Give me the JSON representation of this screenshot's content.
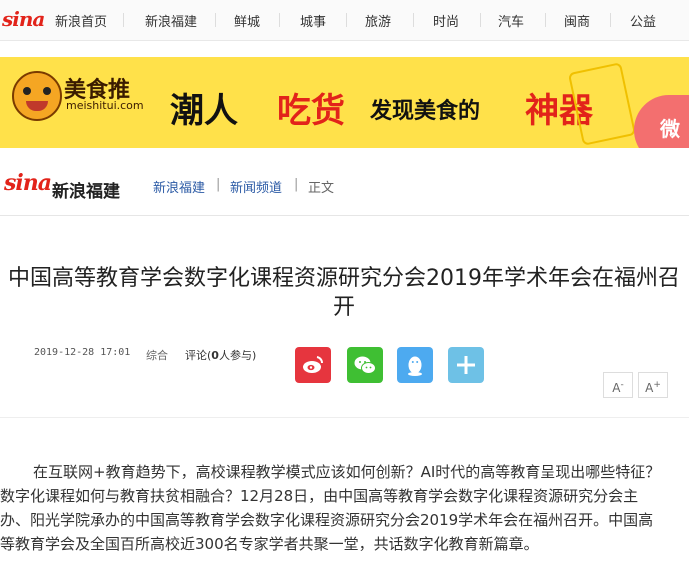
{
  "topnav": {
    "logo": "sina",
    "items": [
      "新浪首页",
      "新浪福建",
      "鲜城",
      "城事",
      "旅游",
      "时尚",
      "汽车",
      "闽商",
      "公益"
    ]
  },
  "banner": {
    "brand": "美食推",
    "domain": "meishitui.com",
    "slogan_part1": "潮人",
    "slogan_part2": "吃货",
    "slogan_part3": "发现美食的",
    "slogan_part4": "神器",
    "badge": "微"
  },
  "channel": {
    "logo": "sina",
    "name": "新浪福建",
    "breadcrumb": [
      "新浪福建",
      "新闻频道",
      "正文"
    ]
  },
  "article": {
    "title": "中国高等教育学会数字化课程资源研究分会2019年学术年会在福州召开",
    "date": "2019-12-28 17:01",
    "source": "综合",
    "comment_label": "评论(",
    "comment_count": "0",
    "comment_suffix": "人参与)",
    "font_smaller": "A",
    "font_larger": "A",
    "paragraph": "在互联网+教育趋势下，高校课程教学模式应该如何创新？AI时代的高等教育呈现出哪些特征？数字化课程如何与教育扶贫相融合？12月28日，由中国高等教育学会数字化课程资源研究分会主办、阳光学院承办的中国高等教育学会数字化课程资源研究分会2019学术年会在福州召开。中国高等教育学会及全国百所高校近300名专家学者共聚一堂，共话数字化教育新篇章。"
  },
  "colors": {
    "accent": "#e2231a",
    "link": "#2b5aa5",
    "banner_bg": "#ffe14a"
  }
}
